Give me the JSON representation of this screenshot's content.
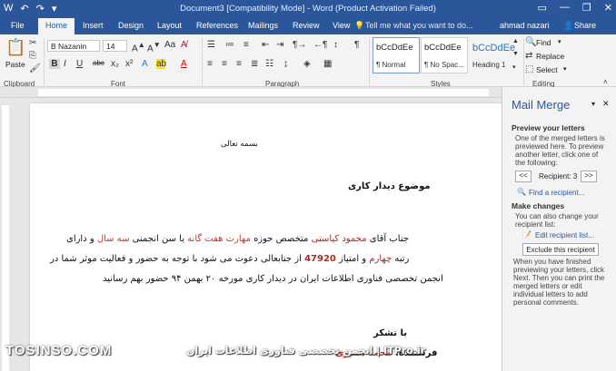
{
  "window": {
    "title": "Document3 [Compatibility Mode] - Word (Product Activation Failed)",
    "qat": [
      "W",
      "↶",
      "↷",
      "▾"
    ],
    "controls": [
      "▭",
      "—",
      "❐",
      "✕"
    ]
  },
  "tabs": {
    "items": [
      "File",
      "Home",
      "Insert",
      "Design",
      "Layout",
      "References",
      "Mailings",
      "Review",
      "View"
    ],
    "active": "Home",
    "tell_me": "Tell me what you want to do...",
    "user": "ahmad nazari",
    "share": "Share"
  },
  "ribbon": {
    "paste": "Paste",
    "font_name": "B Nazanin",
    "font_size": "14",
    "font_buttons": [
      "B",
      "I",
      "U",
      "abc",
      "x₂",
      "x²"
    ],
    "styles": [
      {
        "sample": "bCcDdEe",
        "name": "¶ Normal"
      },
      {
        "sample": "bCcDdEe",
        "name": "¶ No Spac..."
      },
      {
        "sample": "bCcDdEe",
        "name": "Heading 1"
      }
    ],
    "editing": {
      "find": "Find",
      "replace": "Replace",
      "select": "Select"
    },
    "groups": {
      "clipboard": "Clipboard",
      "font": "Font",
      "paragraph": "Paragraph",
      "styles": "Styles",
      "editing": "Editing"
    }
  },
  "document": {
    "header": "بسمه تعالی",
    "subject": "موضوع دیدار کاری",
    "line1": {
      "a": "جناب آقای ",
      "name": "محمود کیاستی",
      "b": " متخصص حوزه ",
      "skill": "مهارت هفت گانه",
      "c": "  با سن انجمنی ",
      "age": "سه سال",
      "d": " و دارای"
    },
    "line2": {
      "a": "رتبه ",
      "rank": "چهارم",
      "b": " و امتیاز ",
      "score": "47920",
      "c": " از جنابعالی دعوت می شود با توجه به حضور و فعالیت موثر شما در"
    },
    "line3": "انجمن تخصصی فناوری اطلاعات ایران در دیدار کاری مورخه ۲۰ بهمن ۹۴ حضور بهم رسانید",
    "thanks": "با تشکر",
    "sender_label": "فرستنده",
    "sender_name": "محمد نصیری"
  },
  "mail_merge": {
    "title": "Mail Merge",
    "preview_heading": "Preview your letters",
    "preview_text": "One of the merged letters is previewed here. To preview another letter, click one of the following:",
    "prev_button": "<<",
    "recipient_label": "Recipient: 3",
    "next_button": ">>",
    "find_recipient": "Find a recipient...",
    "changes_heading": "Make changes",
    "changes_text": "You can also change your recipient list:",
    "edit_list": "Edit recipient list...",
    "exclude": "Exclude this recipient",
    "finish_text": "When you have finished previewing your letters, click Next. Then you can print the merged letters or edit individual letters to add personal comments."
  },
  "watermark": {
    "left": "TOSINSO.COM",
    "right": "ITPro.ir | انجمن تخصصی فناوری اطلاعات ایران"
  }
}
